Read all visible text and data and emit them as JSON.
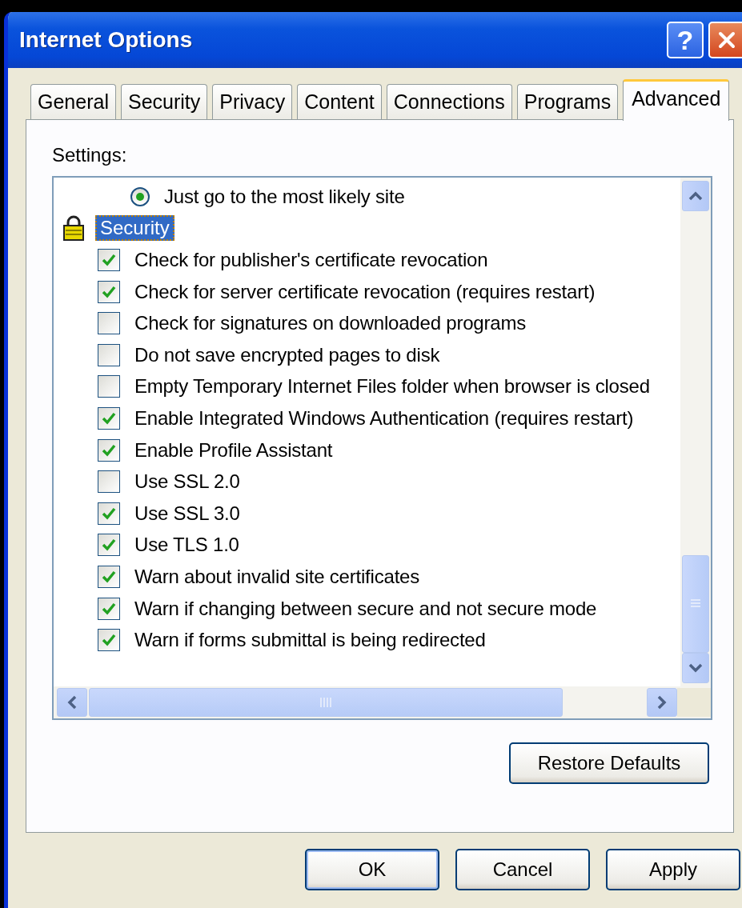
{
  "window": {
    "title": "Internet Options",
    "help_button": "?"
  },
  "tabs": [
    {
      "label": "General",
      "selected": false
    },
    {
      "label": "Security",
      "selected": false
    },
    {
      "label": "Privacy",
      "selected": false
    },
    {
      "label": "Content",
      "selected": false
    },
    {
      "label": "Connections",
      "selected": false
    },
    {
      "label": "Programs",
      "selected": false
    },
    {
      "label": "Advanced",
      "selected": true
    }
  ],
  "settings": {
    "label": "Settings:",
    "items": [
      {
        "kind": "radio",
        "label": "Just go to the most likely site",
        "selected": true
      },
      {
        "kind": "group",
        "label": "Security",
        "selected": true
      },
      {
        "kind": "checkbox",
        "label": "Check for publisher's certificate revocation",
        "checked": true
      },
      {
        "kind": "checkbox",
        "label": "Check for server certificate revocation (requires restart)",
        "checked": true
      },
      {
        "kind": "checkbox",
        "label": "Check for signatures on downloaded programs",
        "checked": false
      },
      {
        "kind": "checkbox",
        "label": "Do not save encrypted pages to disk",
        "checked": false
      },
      {
        "kind": "checkbox",
        "label": "Empty Temporary Internet Files folder when browser is closed",
        "checked": false
      },
      {
        "kind": "checkbox",
        "label": "Enable Integrated Windows Authentication (requires restart)",
        "checked": true
      },
      {
        "kind": "checkbox",
        "label": "Enable Profile Assistant",
        "checked": true
      },
      {
        "kind": "checkbox",
        "label": "Use SSL 2.0",
        "checked": false
      },
      {
        "kind": "checkbox",
        "label": "Use SSL 3.0",
        "checked": true
      },
      {
        "kind": "checkbox",
        "label": "Use TLS 1.0",
        "checked": true
      },
      {
        "kind": "checkbox",
        "label": "Warn about invalid site certificates",
        "checked": true
      },
      {
        "kind": "checkbox",
        "label": "Warn if changing between secure and not secure mode",
        "checked": true
      },
      {
        "kind": "checkbox",
        "label": "Warn if forms submittal is being redirected",
        "checked": true
      }
    ]
  },
  "restore_button": "Restore Defaults",
  "buttons": [
    "OK",
    "Cancel",
    "Apply"
  ]
}
